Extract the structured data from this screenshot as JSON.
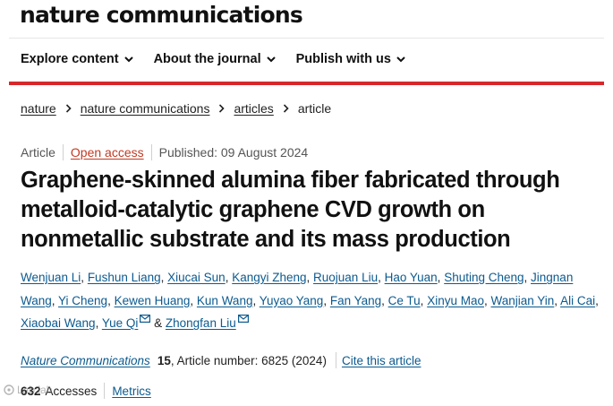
{
  "header": {
    "brand": "nature communications"
  },
  "nav": {
    "items": [
      {
        "label": "Explore content"
      },
      {
        "label": "About the journal"
      },
      {
        "label": "Publish with us"
      }
    ]
  },
  "breadcrumb": [
    "nature",
    "nature communications",
    "articles",
    "article"
  ],
  "meta": {
    "type": "Article",
    "access": "Open access",
    "published": "Published: 09 August 2024"
  },
  "article": {
    "title": "Graphene-skinned alumina fiber fabricated through metalloid-catalytic graphene CVD growth on nonmetallic substrate and its mass production",
    "authors": [
      "Wenjuan Li",
      "Fushun Liang",
      "Xiucai Sun",
      "Kangyi Zheng",
      "Ruojuan Liu",
      "Hao Yuan",
      "Shuting Cheng",
      "Jingnan Wang",
      "Yi Cheng",
      "Kewen Huang",
      "Kun Wang",
      "Yuyao Yang",
      "Fan Yang",
      "Ce Tu",
      "Xinyu Mao",
      "Wanjian Yin",
      "Ali Cai",
      "Xiaobai Wang",
      "Yue Qi",
      "Zhongfan Liu"
    ],
    "authors_and": "&"
  },
  "citation": {
    "journal": "Nature Communications",
    "volume": "15",
    "details": ", Article number: 6825 (2024)",
    "cite_label": "Cite this article"
  },
  "metrics": {
    "accesses_count": "632",
    "accesses_label": "Accesses",
    "metrics_label": "Metrics"
  },
  "watermark": {
    "text": "Lab.lab"
  },
  "colors": {
    "accent_red": "#d6282a",
    "link_blue": "#0c5a8f",
    "open_access": "#c23a22"
  }
}
